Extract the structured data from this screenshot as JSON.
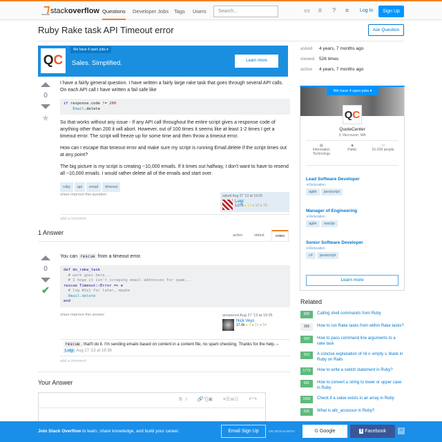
{
  "header": {
    "logo_light": "stack",
    "logo_bold": "overflow",
    "nav": [
      "Questions",
      "Developer Jobs",
      "Tags",
      "Users"
    ],
    "search_placeholder": "Search...",
    "login": "Log In",
    "signup": "Sign Up"
  },
  "question": {
    "title": "Ruby Rake task API Timeout error",
    "ask_button": "Ask Question",
    "votes": "0",
    "para1": "I have a fairly general question. I have written a fairly large rake task that goes through several API calls. On each API call I have written a fail safe like",
    "code_line1_kw": "if",
    "code_line1_rest": " response.code != ",
    "code_line1_num": "200",
    "code_line2_type": "Email",
    "code_line2_rest": ".delete",
    "para2": "So that works without any issue - If any API call throughout the entire script gives a response code of anything other than 200 it will abort. However, out of 100 times it seems like at least 1-2 times I get a timeout error. The script will freeze up for some time and then throw a timeout error.",
    "para3": "How can I escape that timeout error and make sure my script is running Email.delete if the script times out at any point?",
    "para4": "The big picture is my script is creating ~10,000 emails. If it times out halfway, I don't want to have to resend all ~10,000 emails. I would rather delete all of the emails and start over.",
    "tags": [
      "ruby",
      "api",
      "email",
      "timeout"
    ],
    "share": "share",
    "improve": "improve this question",
    "asked": "asked Aug 27 '13 at 19:03",
    "user": "Luigi",
    "rep": "1,575",
    "gold": "● 10",
    "silver": "● 32",
    "bronze": "● 78",
    "add_comment": "add a comment"
  },
  "ad": {
    "jobs": "We have 4 open jobs ▾",
    "tagline": "Sales. Simplified.",
    "button": "Learn more",
    "logo_q": "Q",
    "logo_c": "C"
  },
  "stats": [
    {
      "k": "asked",
      "v": "4 years, 7 months ago"
    },
    {
      "k": "viewed",
      "v": "526 times"
    },
    {
      "k": "active",
      "v": "4 years, 7 months ago"
    }
  ],
  "answers": {
    "heading": "1 Answer",
    "tabs": [
      "active",
      "oldest",
      "votes"
    ],
    "votes": "0",
    "intro_pre": "You can ",
    "intro_code": "rescue",
    "intro_post": " from a timeout error.",
    "code": [
      "def do_rake_task",
      "  # work goes here...",
      "  # I hope it isn't scraping email addresses for spam...",
      "rescue Timeout::Error => e",
      "  # log #{e} for later, maybe",
      "  Email.delete",
      "end"
    ],
    "share": "share",
    "improve": "improve this answer",
    "answered": "answered Aug 27 '13 at 19:25",
    "user": "Nick Veys",
    "rep": "17.4k",
    "gold": "● 4",
    "silver": "● 31",
    "bronze": "● 54",
    "comment_code": "rescue",
    "comment_text": ", that'll do it. I'm sending emails based on content in a content file, no spam checking. Thanks for the help. – ",
    "comment_user": "Luigi",
    "comment_time": "Aug 27 '13 at 19:38",
    "add_comment": "add a comment"
  },
  "your_answer": {
    "heading": "Your Answer",
    "toolbar": [
      "B",
      "I",
      "🔗",
      "“",
      "{}",
      "▣",
      "≡",
      "☰",
      "≣",
      "☷",
      "↶",
      "↷"
    ]
  },
  "jobs_card": {
    "banner": "We have 4 open jobs ▾",
    "company": "QuoteCenter",
    "location": "⚲ Vancouver, WA",
    "facts": [
      {
        "icon": "▤",
        "label": "Information Technology"
      },
      {
        "icon": "■",
        "label": "Public"
      },
      {
        "icon": "⚇",
        "label": "51-200 people"
      }
    ],
    "jobs": [
      {
        "title": "Lead Software Developer",
        "reloc": "✈Relocation",
        "tags": [
          "agile",
          "javascript"
        ]
      },
      {
        "title": "Manager of Engineering",
        "reloc": "✈Relocation",
        "tags": [
          "agile",
          "reactjs"
        ]
      },
      {
        "title": "Senior Software Developer",
        "reloc": "✈Relocation",
        "tags": [
          "c#",
          "javascript"
        ]
      }
    ],
    "button": "Learn more"
  },
  "related": {
    "heading": "Related",
    "items": [
      {
        "n": "836",
        "t": "Calling shell commands from Ruby",
        "a": true
      },
      {
        "n": "365",
        "t": "How to run Rake tasks from within Rake tasks?",
        "a": false
      },
      {
        "n": "929",
        "t": "How to pass command line arguments to a rake task",
        "a": true
      },
      {
        "n": "913",
        "t": "A concise explanation of nil v. empty v. blank in Ruby on Rails",
        "a": true
      },
      {
        "n": "1773",
        "t": "How to write a switch statement in Ruby?",
        "a": true
      },
      {
        "n": "931",
        "t": "How to convert a string to lower or upper case in Ruby",
        "a": true
      },
      {
        "n": "1060",
        "t": "Check if a value exists in an array in Ruby",
        "a": true
      },
      {
        "n": "626",
        "t": "What is attr_accessor in Ruby?",
        "a": true
      }
    ]
  },
  "footer": {
    "bold": "Join Stack Overflow",
    "text": " to learn, share knowledge, and build your career.",
    "email": "Email Sign Up",
    "or": "OR SIGN IN WITH",
    "google": "Google",
    "facebook": "Facebook",
    "close": "✕"
  }
}
